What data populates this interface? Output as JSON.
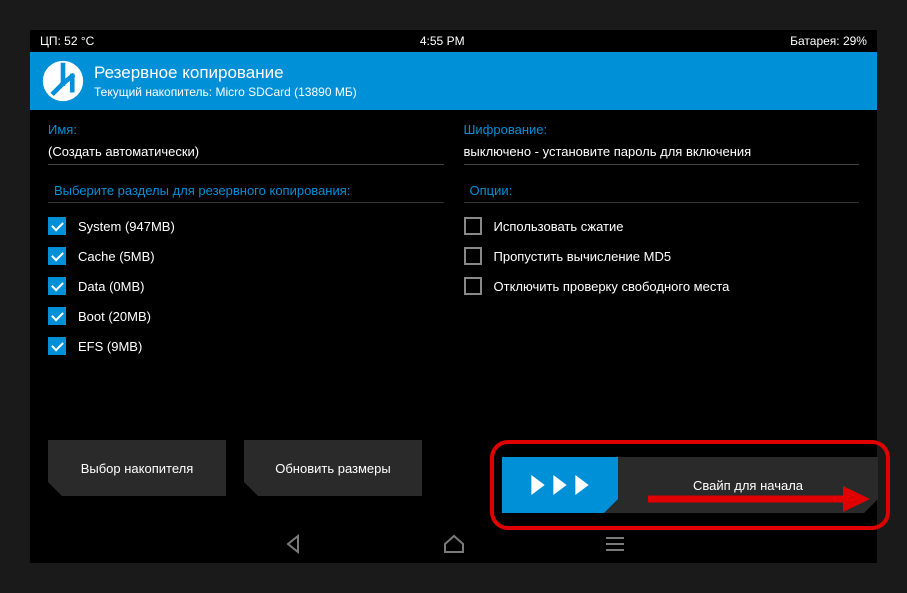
{
  "status": {
    "cpu": "ЦП: 52 °C",
    "time": "4:55 PM",
    "battery": "Батарея: 29%"
  },
  "header": {
    "title": "Резервное копирование",
    "subtitle": "Текущий накопитель: Micro SDCard (13890 МБ)"
  },
  "name": {
    "label": "Имя:",
    "value": "(Создать автоматически)"
  },
  "encryption": {
    "label": "Шифрование:",
    "value": "выключено - установите пароль для включения"
  },
  "partitions": {
    "label": "Выберите разделы для резервного копирования:",
    "items": [
      {
        "label": "System (947MB)",
        "checked": true
      },
      {
        "label": "Cache (5MB)",
        "checked": true
      },
      {
        "label": "Data (0MB)",
        "checked": true
      },
      {
        "label": "Boot (20MB)",
        "checked": true
      },
      {
        "label": "EFS (9MB)",
        "checked": true
      }
    ]
  },
  "options": {
    "label": "Опции:",
    "items": [
      {
        "label": "Использовать сжатие",
        "checked": false
      },
      {
        "label": "Пропустить вычисление MD5",
        "checked": false
      },
      {
        "label": "Отключить проверку свободного места",
        "checked": false
      }
    ]
  },
  "buttons": {
    "storage": "Выбор накопителя",
    "refresh": "Обновить размеры"
  },
  "swipe": {
    "label": "Свайп для начала"
  }
}
